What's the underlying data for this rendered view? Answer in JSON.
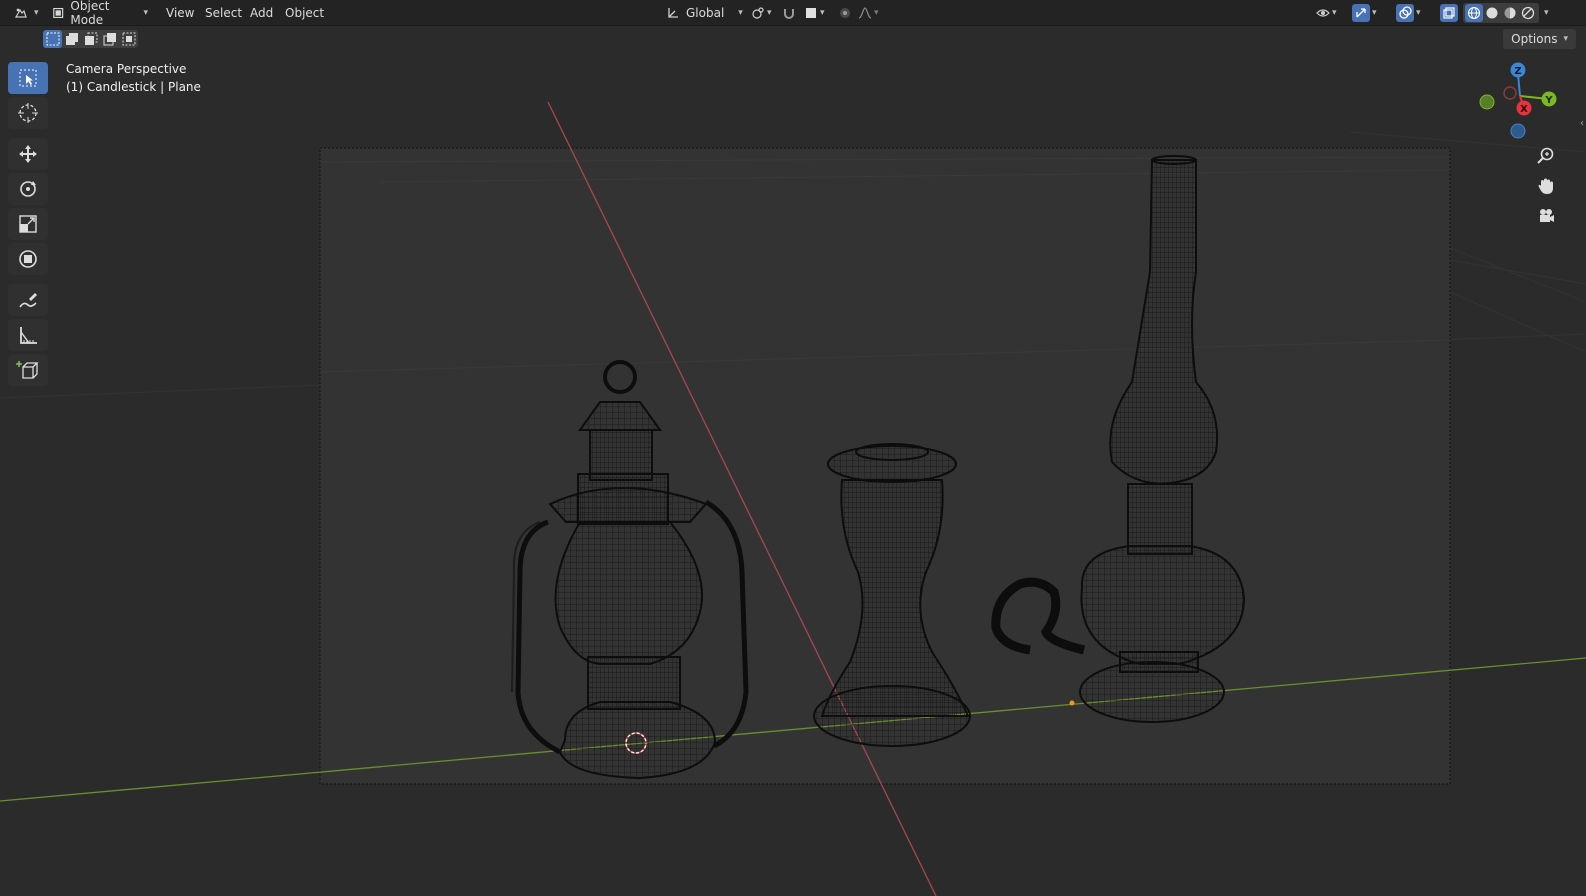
{
  "header": {
    "mode_label": "Object Mode",
    "menus": [
      "View",
      "Select",
      "Add",
      "Object"
    ],
    "orientation_label": "Global",
    "options_label": "Options"
  },
  "viewport": {
    "view_name": "Camera Perspective",
    "active_object": "(1) Candlestick | Plane"
  },
  "gizmo": {
    "z_label": "Z",
    "y_label": "Y",
    "x_label": "X",
    "colors": {
      "x": "#e5333f",
      "y": "#7cb823",
      "z": "#3b86d6"
    }
  },
  "toolbar": {
    "tools": [
      "select-box-icon",
      "cursor-icon",
      "move-icon",
      "rotate-icon",
      "scale-icon",
      "transform-icon",
      "annotate-icon",
      "measure-icon",
      "add-cube-icon"
    ]
  },
  "colors": {
    "accent": "#4772b3",
    "x_axis": "#a8474d",
    "y_axis": "#6b8f2e",
    "wire": "#0d0d0d"
  }
}
